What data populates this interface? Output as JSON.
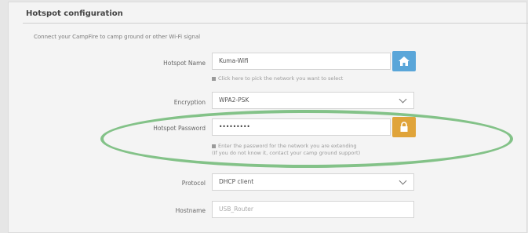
{
  "panel": {
    "title": "Hotspot configuration",
    "subtitle": "Connect your CampFire to camp ground or other Wi-Fi signal"
  },
  "fields": {
    "hotspot_name": {
      "label": "Hotspot Name",
      "value": "Kuma-Wifi",
      "hint": "Click here to pick the network you want to select"
    },
    "encryption": {
      "label": "Encryption",
      "value": "WPA2-PSK"
    },
    "hotspot_password": {
      "label": "Hotspot Password",
      "value": "•••••••••",
      "hint_line1": "Enter the password for the network you are extending",
      "hint_line2": "(If you do not know it, contact your camp ground support)"
    },
    "protocol": {
      "label": "Protocol",
      "value": "DHCP client"
    },
    "hostname": {
      "label": "Hostname",
      "placeholder": "USB_Router"
    }
  },
  "icons": {
    "network_icon": "home-wifi-icon",
    "password_icon": "lock-icon"
  },
  "colors": {
    "accent_blue": "#5aa6d9",
    "accent_orange": "#e0a43a",
    "highlight_green": "#6eb874"
  }
}
